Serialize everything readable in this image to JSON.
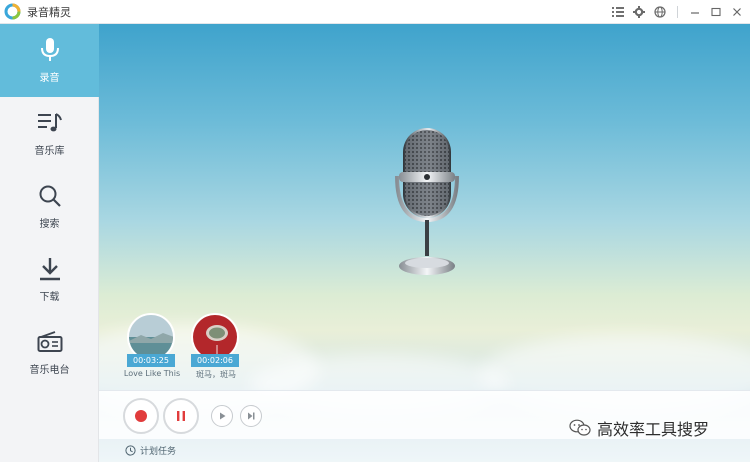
{
  "app": {
    "title": "录音精灵"
  },
  "titlebar": {
    "icons": [
      "list-icon",
      "gear-icon",
      "globe-icon",
      "minimize-icon",
      "maximize-icon",
      "close-icon"
    ]
  },
  "sidebar": {
    "items": [
      {
        "label": "录音",
        "icon": "microphone-icon",
        "active": true
      },
      {
        "label": "音乐库",
        "icon": "music-library-icon",
        "active": false
      },
      {
        "label": "搜索",
        "icon": "search-icon",
        "active": false
      },
      {
        "label": "下载",
        "icon": "download-icon",
        "active": false
      },
      {
        "label": "音乐电台",
        "icon": "radio-icon",
        "active": false
      }
    ]
  },
  "recordings": [
    {
      "time": "00:03:25",
      "name": "Love Like This"
    },
    {
      "time": "00:02:06",
      "name": "斑马，斑马"
    }
  ],
  "controls": {
    "record": "record-button",
    "pause": "pause-button",
    "play": "play-button",
    "next": "next-button"
  },
  "footer": {
    "task_label": "计划任务"
  },
  "watermark": {
    "text": "高效率工具搜罗"
  },
  "colors": {
    "accent": "#62bcdb",
    "record_red": "#e13c3c",
    "time_badge": "#4aa8d4"
  }
}
